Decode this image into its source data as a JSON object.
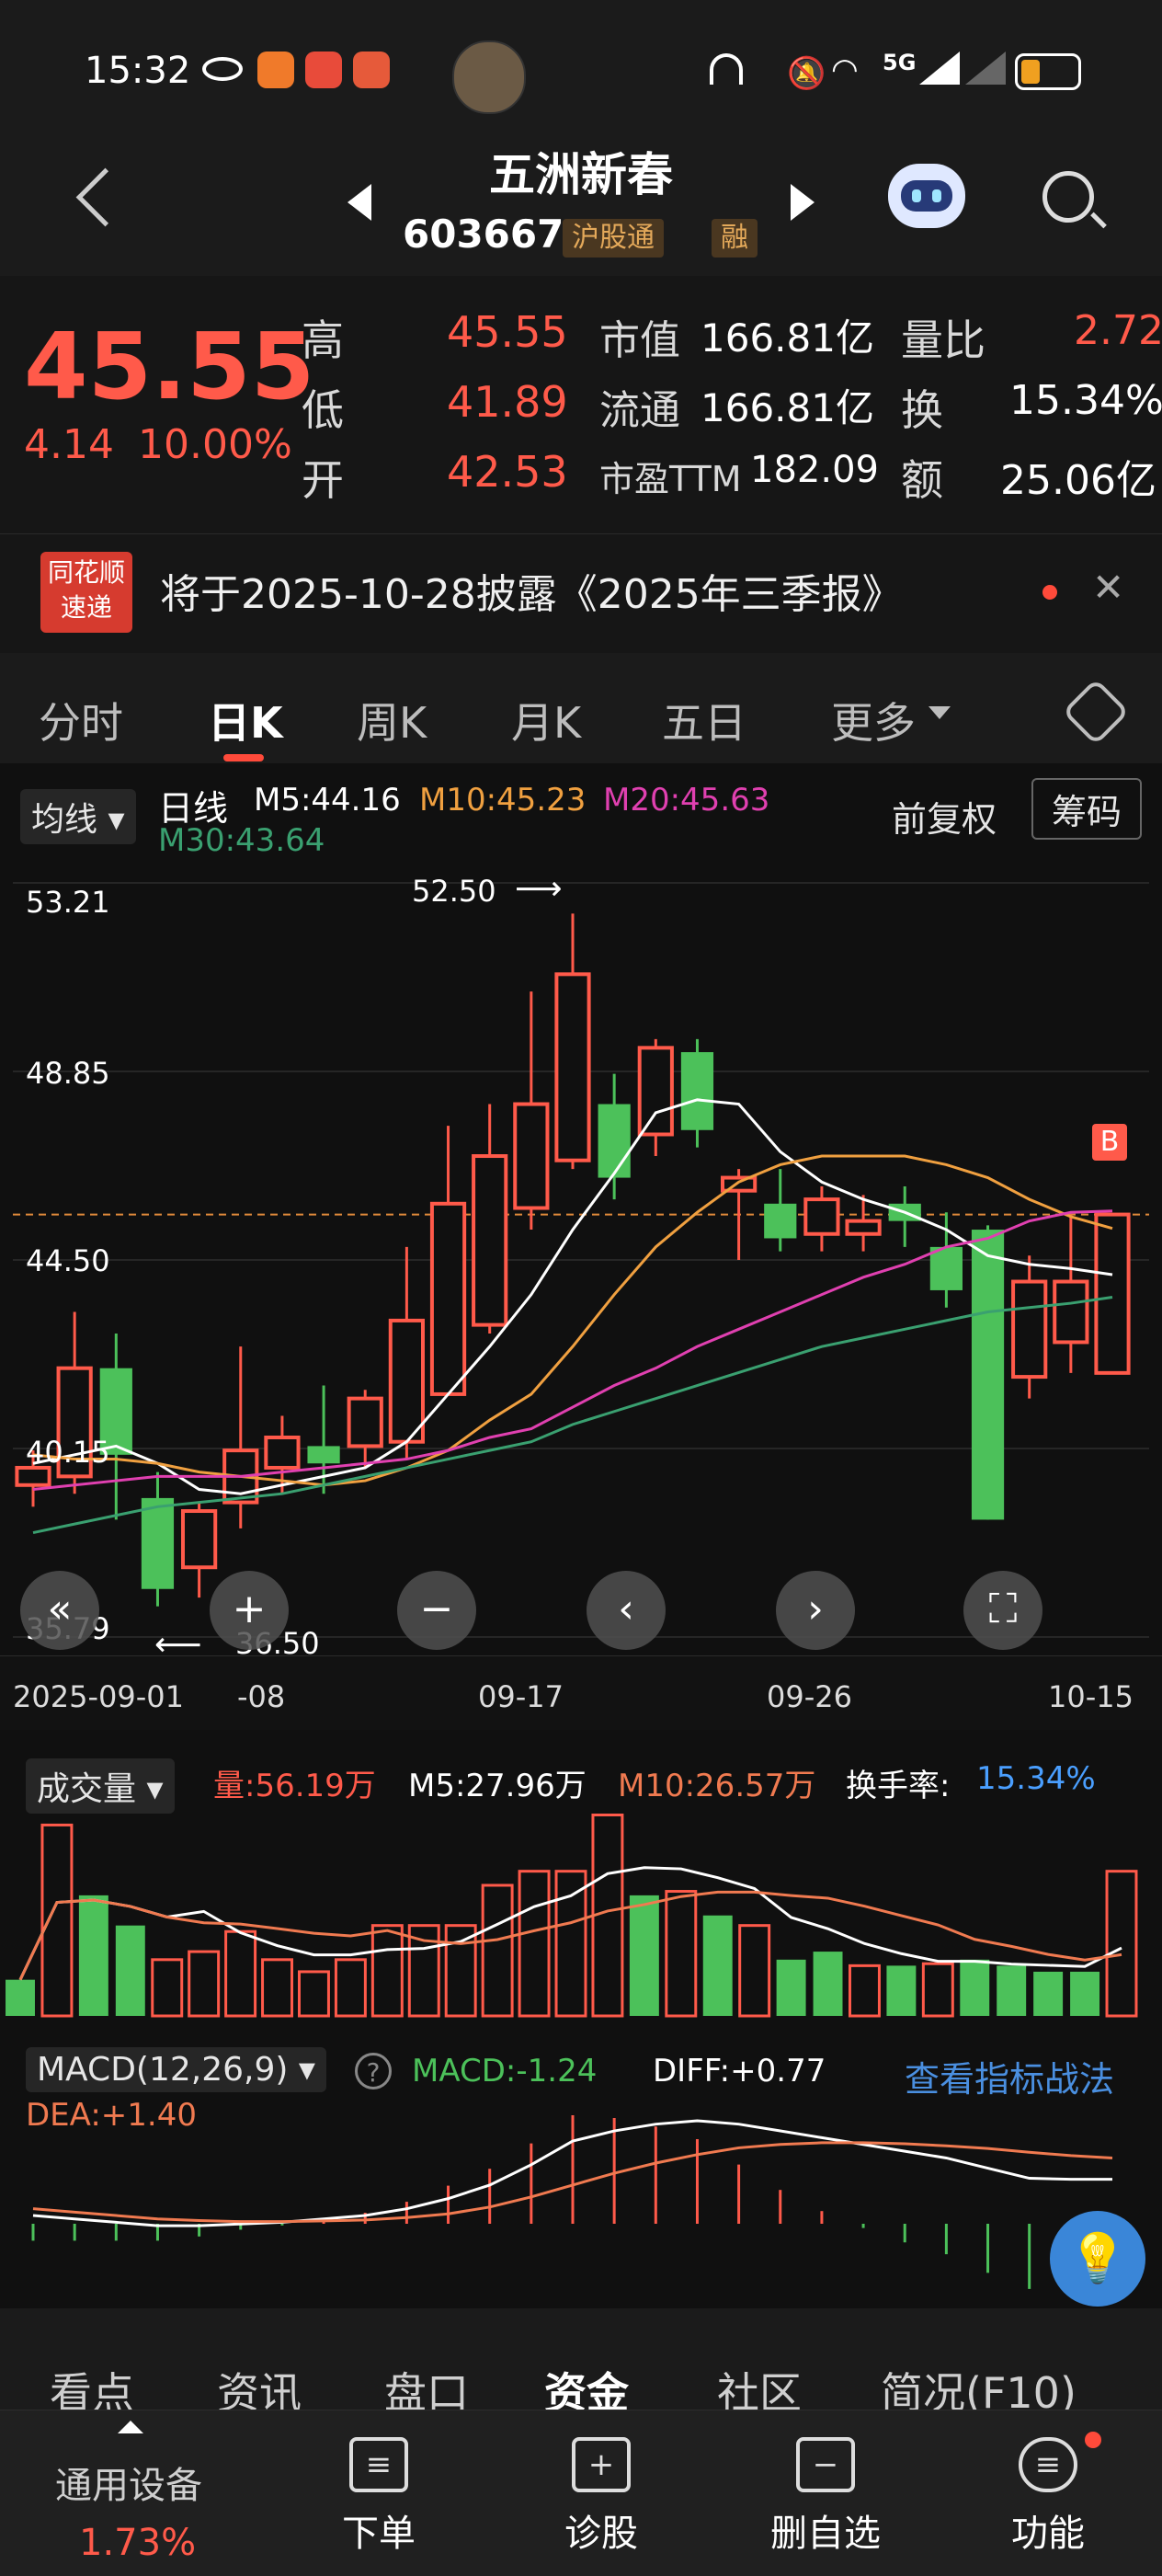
{
  "status": {
    "time": "15:32",
    "network": "5G"
  },
  "header": {
    "name": "五洲新春",
    "code": "603667",
    "tags": [
      "沪股通",
      "融"
    ]
  },
  "quote": {
    "price": "45.55",
    "change": "4.14",
    "change_pct": "10.00%",
    "high_label": "高",
    "high": "45.55",
    "low_label": "低",
    "low": "41.89",
    "open_label": "开",
    "open": "42.53",
    "mcap_label": "市值",
    "mcap": "166.81亿",
    "float_label": "流通",
    "float": "166.81亿",
    "pe_label": "市盈TTM",
    "pe": "182.09",
    "vr_label": "量比",
    "vr": "2.72",
    "turnover_label": "换",
    "turnover": "15.34%",
    "amount_label": "额",
    "amount": "25.06亿"
  },
  "news": {
    "logo_top": "同花顺",
    "logo_bottom": "速递",
    "text": "将于2025-10-28披露《2025年三季报》"
  },
  "tabs": [
    "分时",
    "日K",
    "周K",
    "月K",
    "五日",
    "更多"
  ],
  "chart_header": {
    "ma_pill": "均线",
    "period": "日线",
    "m5": "M5:44.16",
    "m10": "M10:45.23",
    "m20": "M20:45.63",
    "m30": "M30:43.64",
    "adjust": "前复权",
    "chips": "筹码"
  },
  "colors": {
    "up": "#ff5a4a",
    "down": "#4cc15a",
    "m5": "#ffffff",
    "m10": "#f0a040",
    "m20": "#e040b0",
    "m30": "#3aa070"
  },
  "y_axis": [
    "53.21",
    "48.85",
    "44.50",
    "40.15",
    "35.79"
  ],
  "annotations": {
    "high": "52.50",
    "low": "36.50",
    "buy": "B"
  },
  "x_axis": [
    "2025-09-01",
    "-08",
    "09-17",
    "09-26",
    "10-15"
  ],
  "chart_data": {
    "type": "candlestick",
    "dates": [
      "09-01",
      "09-02",
      "09-03",
      "09-04",
      "09-05",
      "09-08",
      "09-09",
      "09-10",
      "09-11",
      "09-12",
      "09-15",
      "09-16",
      "09-17",
      "09-18",
      "09-19",
      "09-22",
      "09-23",
      "09-24",
      "09-25",
      "09-26",
      "09-29",
      "09-30",
      "10-09",
      "10-10",
      "10-13",
      "10-14",
      "10-15"
    ],
    "open": [
      39.3,
      39.5,
      42.0,
      39.0,
      37.4,
      38.9,
      39.7,
      40.2,
      40.2,
      40.3,
      41.4,
      43.0,
      45.7,
      46.8,
      48.1,
      47.4,
      49.3,
      46.1,
      45.8,
      45.1,
      45.1,
      45.8,
      44.8,
      45.2,
      41.8,
      42.6,
      41.89
    ],
    "close": [
      39.7,
      42.0,
      40.0,
      36.9,
      38.7,
      40.1,
      40.4,
      39.8,
      41.3,
      43.1,
      45.8,
      46.9,
      48.1,
      51.1,
      46.4,
      49.4,
      47.5,
      46.4,
      45.0,
      45.9,
      45.4,
      45.4,
      43.8,
      38.5,
      44.0,
      44.0,
      45.55
    ],
    "high": [
      40.1,
      43.3,
      42.8,
      39.6,
      38.9,
      42.5,
      40.9,
      41.6,
      41.5,
      44.8,
      47.6,
      48.1,
      50.7,
      52.5,
      48.8,
      49.6,
      49.6,
      46.6,
      46.6,
      46.2,
      46.0,
      46.2,
      45.6,
      45.3,
      44.6,
      45.55,
      45.55
    ],
    "low": [
      38.8,
      39.1,
      38.5,
      36.5,
      36.7,
      38.3,
      39.1,
      39.1,
      39.7,
      39.9,
      41.7,
      42.8,
      45.2,
      46.6,
      45.9,
      46.9,
      47.1,
      44.5,
      44.7,
      44.7,
      44.7,
      44.8,
      43.4,
      38.5,
      41.3,
      41.89,
      41.89
    ],
    "ma": {
      "M5": [
        39.8,
        40.0,
        40.2,
        39.8,
        39.2,
        39.1,
        39.3,
        39.5,
        39.7,
        40.3,
        41.4,
        42.5,
        43.7,
        45.2,
        46.5,
        47.9,
        48.2,
        48.1,
        47.0,
        46.3,
        45.9,
        45.6,
        45.2,
        44.6,
        44.4,
        44.3,
        44.16
      ],
      "M10": [
        40.0,
        39.9,
        39.9,
        39.8,
        39.6,
        39.5,
        39.4,
        39.3,
        39.4,
        39.7,
        40.1,
        40.8,
        41.4,
        42.5,
        43.7,
        44.8,
        45.6,
        46.3,
        46.7,
        46.9,
        46.9,
        46.9,
        46.7,
        46.4,
        45.9,
        45.5,
        45.23
      ],
      "M20": [
        39.2,
        39.3,
        39.4,
        39.5,
        39.5,
        39.5,
        39.6,
        39.7,
        39.8,
        39.9,
        40.1,
        40.4,
        40.6,
        41.1,
        41.6,
        42.0,
        42.5,
        42.9,
        43.3,
        43.7,
        44.1,
        44.4,
        44.8,
        45.0,
        45.4,
        45.6,
        45.63
      ],
      "M30": [
        38.2,
        38.4,
        38.6,
        38.8,
        38.9,
        39.0,
        39.1,
        39.3,
        39.5,
        39.7,
        39.9,
        40.1,
        40.3,
        40.7,
        41.0,
        41.3,
        41.6,
        41.9,
        42.2,
        42.5,
        42.7,
        42.9,
        43.1,
        43.3,
        43.4,
        43.5,
        43.64
      ]
    },
    "ylim": [
      35.79,
      53.21
    ]
  },
  "volume": {
    "label": "成交量",
    "vol": "量:56.19万",
    "m5": "M5:27.96万",
    "m10": "M10:26.57万",
    "turnover_label": "换手率:",
    "turnover": "15.34%",
    "values": [
      0.18,
      0.95,
      0.6,
      0.45,
      0.28,
      0.32,
      0.42,
      0.28,
      0.22,
      0.28,
      0.45,
      0.45,
      0.45,
      0.65,
      0.72,
      0.72,
      1.0,
      0.6,
      0.62,
      0.5,
      0.45,
      0.28,
      0.32,
      0.25,
      0.25,
      0.26,
      0.28,
      0.25,
      0.22,
      0.22,
      0.72
    ]
  },
  "macd": {
    "label": "MACD(12,26,9)",
    "macd": "MACD:-1.24",
    "diff": "DIFF:+0.77",
    "dea": "DEA:+1.40",
    "link": "查看指标战法"
  },
  "bottom_tabs": [
    "看点",
    "资讯",
    "盘口",
    "资金",
    "社区",
    "简况(F10)"
  ],
  "nav": {
    "market_label": "通用设备",
    "market_pct": "1.73%",
    "items": [
      "下单",
      "诊股",
      "删自选",
      "功能"
    ]
  }
}
